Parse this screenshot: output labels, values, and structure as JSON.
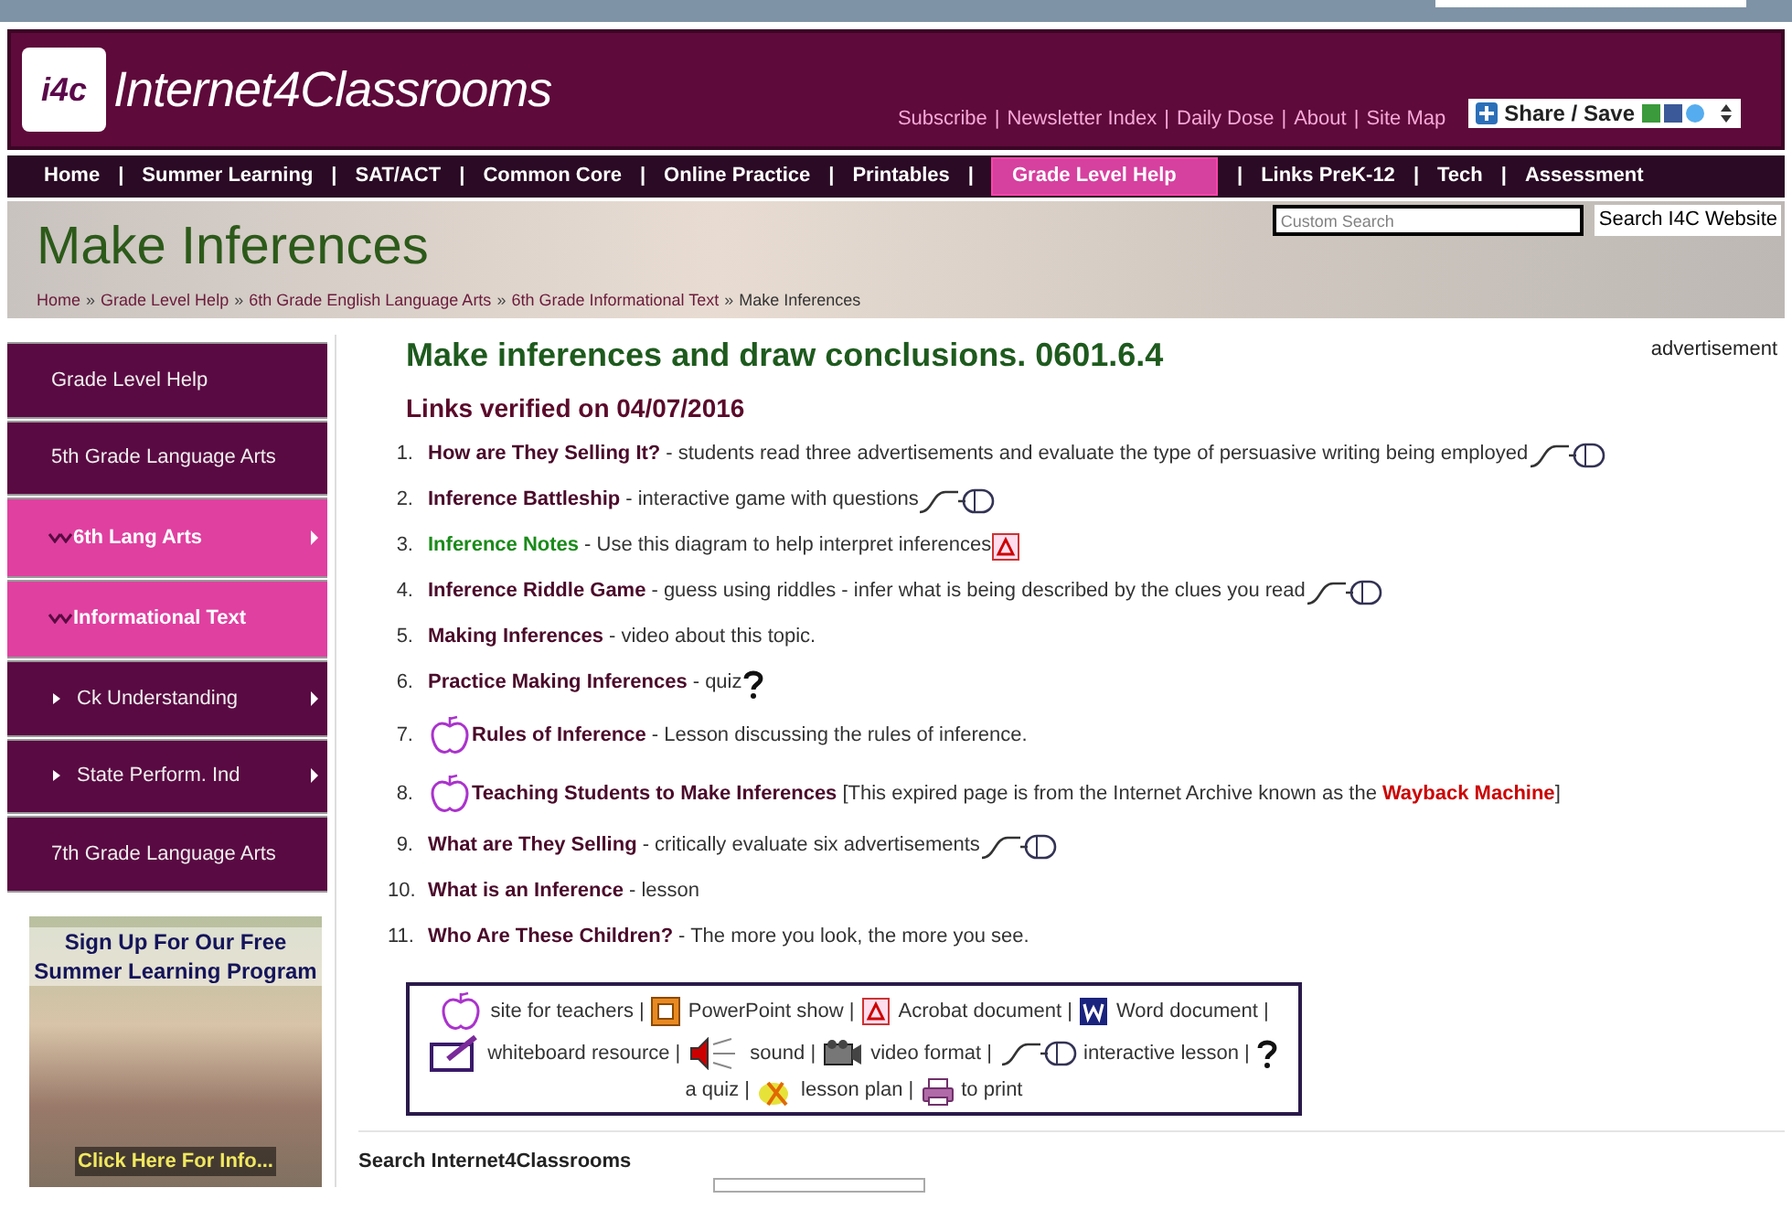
{
  "header": {
    "logo_badge": "i4c",
    "site_name": "Internet4Classrooms",
    "links": [
      "Subscribe",
      "Newsletter Index",
      "Daily Dose",
      "About",
      "Site Map"
    ],
    "separator": "|",
    "share_button": "Share / Save"
  },
  "nav": {
    "separator": "|",
    "tabs": [
      {
        "label": "Home",
        "selected": false
      },
      {
        "label": "Summer Learning",
        "selected": false
      },
      {
        "label": "SAT/ACT",
        "selected": false
      },
      {
        "label": "Common Core",
        "selected": false
      },
      {
        "label": "Online Practice",
        "selected": false
      },
      {
        "label": "Printables",
        "selected": false
      },
      {
        "label": "Grade Level Help",
        "selected": true
      },
      {
        "label": "Links PreK-12",
        "selected": false
      },
      {
        "label": "Tech",
        "selected": false
      },
      {
        "label": "Assessment",
        "selected": false
      }
    ]
  },
  "banner": {
    "title": "Make Inferences",
    "search": {
      "placeholder": "Custom Search",
      "button": "Search I4C Website"
    },
    "breadcrumb_separator": "»",
    "breadcrumb": [
      "Home",
      "Grade Level Help",
      "6th Grade English Language Arts",
      "6th Grade Informational Text",
      "Make Inferences"
    ]
  },
  "sidebar": {
    "items": [
      {
        "label": "Grade Level Help",
        "kind": "plain",
        "submenu": false
      },
      {
        "label": "5th Grade Language Arts",
        "kind": "plain",
        "submenu": false
      },
      {
        "label": "6th Lang Arts",
        "kind": "open",
        "submenu": true
      },
      {
        "label": "Informational Text",
        "kind": "open",
        "submenu": false
      },
      {
        "label": "Ck Understanding",
        "kind": "sub",
        "submenu": true
      },
      {
        "label": "State Perform. Ind",
        "kind": "sub",
        "submenu": true
      },
      {
        "label": "7th Grade Language Arts",
        "kind": "plain",
        "submenu": false
      }
    ],
    "promo": {
      "heading": "Sign Up For Our Free Summer Learning Program",
      "footer": "Click Here For Info..."
    }
  },
  "main": {
    "title": "Make inferences and draw conclusions. 0601.6.4",
    "advertisement": "advertisement",
    "verified": "Links verified on 04/07/2016",
    "links": [
      {
        "number": "1.",
        "title": "How are They Selling It?",
        "description": "- students read three advertisements and evaluate the type of persuasive writing being employed",
        "teacher_site": false,
        "kind": "interactive",
        "visited": false
      },
      {
        "number": "2.",
        "title": "Inference  Battleship",
        "description": "- interactive game with questions",
        "teacher_site": false,
        "kind": "interactive",
        "visited": false
      },
      {
        "number": "3.",
        "title": "Inference  Notes",
        "description": "- Use this diagram to help interpret inferences",
        "teacher_site": false,
        "kind": "acrobat",
        "visited": true
      },
      {
        "number": "4.",
        "title": "Inference  Riddle Game",
        "description": "- guess using riddles - infer what is being described by the clues you read",
        "teacher_site": false,
        "kind": "interactive",
        "visited": false
      },
      {
        "number": "5.",
        "title": "Making  Inferences",
        "description": " - video about this topic.",
        "teacher_site": false,
        "kind": "plain",
        "visited": false
      },
      {
        "number": "6.",
        "title": "Practice Making Inferences",
        "description": " - quiz",
        "teacher_site": false,
        "kind": "quiz",
        "visited": false
      },
      {
        "number": "7.",
        "title": "Rules of Inference",
        "description": " - Lesson discussing the rules of inference.",
        "teacher_site": true,
        "kind": "plain",
        "visited": false
      },
      {
        "number": "8.",
        "title": "Teaching  Students to Make Inferences",
        "description": " [This expired page is from the Internet Archive known as the",
        "link": "Wayback Machine",
        "after": " ]",
        "teacher_site": true,
        "kind": "plain",
        "visited": false
      },
      {
        "number": "9.",
        "title": "What are They Selling",
        "description": " - critically evaluate six advertisements",
        "teacher_site": false,
        "kind": "interactive",
        "visited": false
      },
      {
        "number": "10.",
        "title": "What is an Inference",
        "description": " - lesson",
        "teacher_site": false,
        "kind": "plain",
        "visited": false
      },
      {
        "number": "11.",
        "title": "Who Are These Children?",
        "description": " - The more you look, the more you see.",
        "teacher_site": false,
        "kind": "plain",
        "visited": false
      }
    ],
    "legend": [
      {
        "kind": "apple",
        "label": "site for teachers |"
      },
      {
        "kind": "powerpoint",
        "label": "PowerPoint show |"
      },
      {
        "kind": "acrobat",
        "label": "Acrobat document |"
      },
      {
        "kind": "word",
        "label": "Word document |"
      },
      {
        "kind": "whiteboard",
        "label": "whiteboard resource |"
      },
      {
        "kind": "sound",
        "label": "sound |"
      },
      {
        "kind": "video",
        "label": "video format |"
      },
      {
        "kind": "interactive",
        "label": "interactive lesson |"
      },
      {
        "kind": "quiz",
        "label": "a quiz |"
      },
      {
        "kind": "lessonplan",
        "label": "lesson plan |"
      },
      {
        "kind": "print",
        "label": "to print"
      }
    ],
    "site_search": {
      "label": "Search Internet4Classrooms"
    }
  }
}
